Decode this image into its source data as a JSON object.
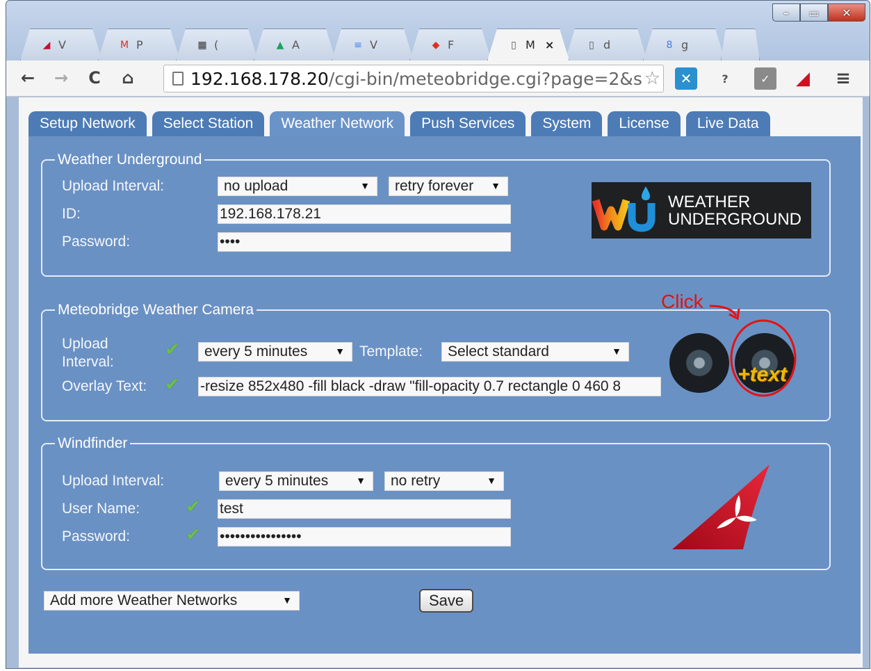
{
  "browser": {
    "tabs": [
      {
        "label": "V",
        "icon": "acrobat-icon",
        "color": "#c8102e"
      },
      {
        "label": "P",
        "icon": "gmail-icon",
        "color": "#d93025"
      },
      {
        "label": "(",
        "icon": "trello-icon",
        "color": "#333333"
      },
      {
        "label": "A",
        "icon": "drive-icon",
        "color": "#1aa260"
      },
      {
        "label": "V",
        "icon": "docs-icon",
        "color": "#4285f4"
      },
      {
        "label": "F",
        "icon": "fritz-icon",
        "color": "#e03020"
      },
      {
        "label": "M",
        "icon": "page-icon",
        "color": "#555555",
        "active": true,
        "close": "×"
      },
      {
        "label": "d",
        "icon": "page-icon",
        "color": "#555555"
      },
      {
        "label": "g",
        "icon": "google-icon",
        "color": "#4a7be0"
      }
    ],
    "url_host": "192.168.178.20",
    "url_path": "/cgi-bin/meteobridge.cgi?page=2&s",
    "ext_help_label": "?"
  },
  "nav": {
    "tabs": [
      "Setup Network",
      "Select Station",
      "Weather Network",
      "Push Services",
      "System",
      "License",
      "Live Data"
    ],
    "active_index": 2
  },
  "wu": {
    "legend": "Weather Underground",
    "upload_label": "Upload Interval:",
    "upload_value": "no upload",
    "retry_value": "retry forever",
    "id_label": "ID:",
    "id_value": "192.168.178.21",
    "password_label": "Password:",
    "password_value": "••••",
    "logo_line1": "WEATHER",
    "logo_line2": "UNDERGROUND"
  },
  "camera": {
    "legend": "Meteobridge Weather Camera",
    "upload_label_1": "Upload",
    "upload_label_2": "Interval:",
    "upload_value": "every 5 minutes",
    "template_label": "Template:",
    "template_value": "Select standard",
    "overlay_label": "Overlay Text:",
    "overlay_value": "-resize 852x480 -fill black -draw \"fill-opacity 0.7 rectangle 0 460 8",
    "click_note": "Click",
    "plus_text": "+text"
  },
  "windfinder": {
    "legend": "Windfinder",
    "upload_label": "Upload Interval:",
    "upload_value": "every 5 minutes",
    "retry_value": "no retry",
    "username_label": "User Name:",
    "username_value": "test",
    "password_label": "Password:",
    "password_value": "••••••••••••••••"
  },
  "footer": {
    "add_networks": "Add more Weather Networks",
    "save_label": "Save"
  },
  "colors": {
    "content_bg": "#6a91c4",
    "tab_bg": "#4d7bb5",
    "check": "#6cc04a",
    "annotation": "#e81010"
  }
}
